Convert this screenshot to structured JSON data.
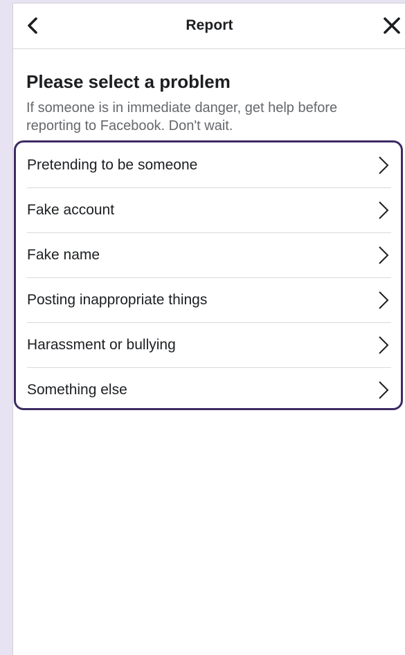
{
  "header": {
    "title": "Report",
    "back_icon": "chevron-left-icon",
    "close_icon": "close-icon"
  },
  "content": {
    "title": "Please select a problem",
    "subtitle": "If someone is in immediate danger, get help before reporting to Facebook. Don't wait."
  },
  "options": [
    {
      "label": "Pretending to be someone",
      "icon": "chevron-right-icon"
    },
    {
      "label": "Fake account",
      "icon": "chevron-right-icon"
    },
    {
      "label": "Fake name",
      "icon": "chevron-right-icon"
    },
    {
      "label": "Posting inappropriate things",
      "icon": "chevron-right-icon"
    },
    {
      "label": "Harassment or bullying",
      "icon": "chevron-right-icon"
    },
    {
      "label": "Something else",
      "icon": "chevron-right-icon"
    }
  ],
  "colors": {
    "highlight_border": "#3d2a63",
    "background": "#e8e3f2",
    "text_primary": "#1c1e21",
    "text_secondary": "#65676b"
  }
}
